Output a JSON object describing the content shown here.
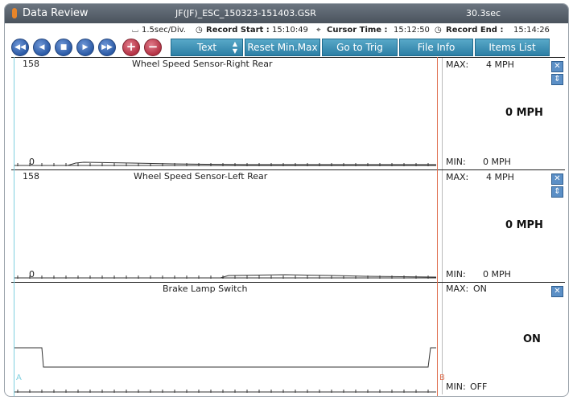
{
  "title": {
    "app": "Data Review",
    "file": "JF(JF)_ESC_150323-151403.GSR",
    "duration": "30.3sec"
  },
  "info": {
    "scale": "1.5sec/Div.",
    "record_start_label": "Record Start :",
    "record_start": "15:10:49",
    "cursor_time_label": "Cursor Time :",
    "cursor_time": "15:12:50",
    "record_end_label": "Record End :",
    "record_end": "15:14:26"
  },
  "toolbar": {
    "text_select": "Text",
    "reset_minmax": "Reset Min.Max",
    "goto_trig": "Go to Trig",
    "file_info": "File Info",
    "items_list": "Items List"
  },
  "panes": [
    {
      "name": "Wheel Speed Sensor-Right Rear",
      "ymax": "158",
      "ymin": "0",
      "max_label": "MAX:",
      "max": "4 MPH",
      "current": "0 MPH",
      "min_label": "MIN:",
      "min": "0 MPH"
    },
    {
      "name": "Wheel Speed Sensor-Left Rear",
      "ymax": "158",
      "ymin": "0",
      "max_label": "MAX:",
      "max": "4 MPH",
      "current": "0 MPH",
      "min_label": "MIN:",
      "min": "0 MPH"
    },
    {
      "name": "Brake Lamp Switch",
      "max_label": "MAX:",
      "max": "ON",
      "current": "ON",
      "min_label": "MIN:",
      "min": "OFF"
    }
  ],
  "cursors": {
    "a": "A",
    "b": "B"
  },
  "colors": {
    "cursor_a": "#7fd0e0",
    "cursor_b": "#e07050",
    "toolbar": "#2c7fa5"
  }
}
